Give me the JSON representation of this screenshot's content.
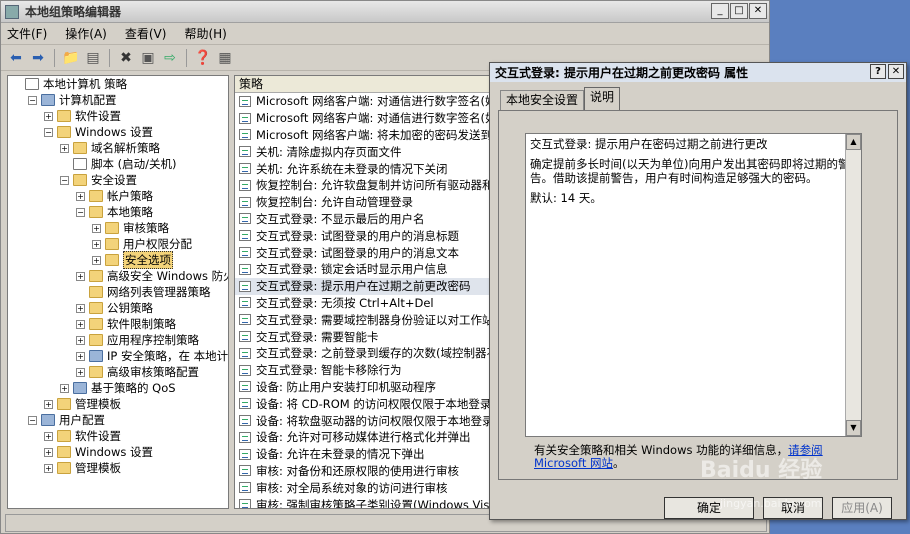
{
  "main_window": {
    "title": "本地组策略编辑器",
    "menu": [
      "文件(F)",
      "操作(A)",
      "查看(V)",
      "帮助(H)"
    ]
  },
  "tree": [
    {
      "indent": 0,
      "exp": "",
      "icon": "doc",
      "label": "本地计算机 策略"
    },
    {
      "indent": 1,
      "exp": "−",
      "icon": "comp",
      "label": "计算机配置"
    },
    {
      "indent": 2,
      "exp": "+",
      "icon": "fold",
      "label": "软件设置"
    },
    {
      "indent": 2,
      "exp": "−",
      "icon": "fold",
      "label": "Windows 设置"
    },
    {
      "indent": 3,
      "exp": "+",
      "icon": "fold",
      "label": "域名解析策略"
    },
    {
      "indent": 3,
      "exp": "",
      "icon": "doc",
      "label": "脚本 (启动/关机)"
    },
    {
      "indent": 3,
      "exp": "−",
      "icon": "lock",
      "label": "安全设置"
    },
    {
      "indent": 4,
      "exp": "+",
      "icon": "lock",
      "label": "帐户策略"
    },
    {
      "indent": 4,
      "exp": "−",
      "icon": "lock",
      "label": "本地策略"
    },
    {
      "indent": 5,
      "exp": "+",
      "icon": "lock",
      "label": "审核策略"
    },
    {
      "indent": 5,
      "exp": "+",
      "icon": "lock",
      "label": "用户权限分配"
    },
    {
      "indent": 5,
      "exp": "+",
      "icon": "lock",
      "label": "安全选项",
      "selected": true
    },
    {
      "indent": 4,
      "exp": "+",
      "icon": "fold",
      "label": "高级安全 Windows 防火墙"
    },
    {
      "indent": 4,
      "exp": "",
      "icon": "fold",
      "label": "网络列表管理器策略"
    },
    {
      "indent": 4,
      "exp": "+",
      "icon": "fold",
      "label": "公钥策略"
    },
    {
      "indent": 4,
      "exp": "+",
      "icon": "fold",
      "label": "软件限制策略"
    },
    {
      "indent": 4,
      "exp": "+",
      "icon": "fold",
      "label": "应用程序控制策略"
    },
    {
      "indent": 4,
      "exp": "+",
      "icon": "comp",
      "label": "IP 安全策略，在 本地计算机"
    },
    {
      "indent": 4,
      "exp": "+",
      "icon": "fold",
      "label": "高级审核策略配置"
    },
    {
      "indent": 3,
      "exp": "+",
      "icon": "comp",
      "label": "基于策略的 QoS"
    },
    {
      "indent": 2,
      "exp": "+",
      "icon": "fold",
      "label": "管理模板"
    },
    {
      "indent": 1,
      "exp": "−",
      "icon": "comp",
      "label": "用户配置"
    },
    {
      "indent": 2,
      "exp": "+",
      "icon": "fold",
      "label": "软件设置"
    },
    {
      "indent": 2,
      "exp": "+",
      "icon": "fold",
      "label": "Windows 设置"
    },
    {
      "indent": 2,
      "exp": "+",
      "icon": "fold",
      "label": "管理模板"
    }
  ],
  "policy_list": {
    "header": "策略",
    "rows": [
      {
        "label": "Microsoft 网络客户端: 对通信进行数字签名(始终)"
      },
      {
        "label": "Microsoft 网络客户端: 对通信进行数字签名(如果服务器允许)"
      },
      {
        "label": "Microsoft 网络客户端: 将未加密的密码发送到第三方 SMB 服务器"
      },
      {
        "label": "关机: 清除虚拟内存页面文件"
      },
      {
        "label": "关机: 允许系统在未登录的情况下关闭"
      },
      {
        "label": "恢复控制台: 允许软盘复制并访问所有驱动器和所有文件夹"
      },
      {
        "label": "恢复控制台: 允许自动管理登录"
      },
      {
        "label": "交互式登录: 不显示最后的用户名"
      },
      {
        "label": "交互式登录: 试图登录的用户的消息标题"
      },
      {
        "label": "交互式登录: 试图登录的用户的消息文本"
      },
      {
        "label": "交互式登录: 锁定会话时显示用户信息"
      },
      {
        "label": "交互式登录: 提示用户在过期之前更改密码",
        "highlight": true
      },
      {
        "label": "交互式登录: 无须按 Ctrl+Alt+Del"
      },
      {
        "label": "交互式登录: 需要域控制器身份验证以对工作站进行解锁"
      },
      {
        "label": "交互式登录: 需要智能卡"
      },
      {
        "label": "交互式登录: 之前登录到缓存的次数(域控制器不可用时)"
      },
      {
        "label": "交互式登录: 智能卡移除行为"
      },
      {
        "label": "设备: 防止用户安装打印机驱动程序"
      },
      {
        "label": "设备: 将 CD-ROM 的访问权限仅限于本地登录的用户"
      },
      {
        "label": "设备: 将软盘驱动器的访问权限仅限于本地登录的用户"
      },
      {
        "label": "设备: 允许对可移动媒体进行格式化并弹出"
      },
      {
        "label": "设备: 允许在未登录的情况下弹出"
      },
      {
        "label": "审核: 对备份和还原权限的使用进行审核"
      },
      {
        "label": "审核: 对全局系统对象的访问进行审核"
      },
      {
        "label": "审核: 强制审核策略子类别设置(Windows Vista 或更高版本)"
      }
    ]
  },
  "dialog": {
    "title": "交互式登录: 提示用户在过期之前更改密码 属性",
    "tabs": [
      "本地安全设置",
      "说明"
    ],
    "active_tab": 1,
    "description_title": "交互式登录: 提示用户在密码过期之前进行更改",
    "description_body": "确定提前多长时间(以天为单位)向用户发出其密码即将过期的警告。借助该提前警告，用户有时间构造足够强大的密码。",
    "default_text": "默认: 14 天。",
    "help_prefix": "有关安全策略和相关 Windows 功能的详细信息，",
    "help_link": "请参阅 Microsoft 网站",
    "help_suffix": "。",
    "ok": "确定",
    "cancel": "取消",
    "apply": "应用(A)"
  },
  "watermark": {
    "text": "Baidu 经验",
    "sub": "jingyan.baidu.com"
  }
}
